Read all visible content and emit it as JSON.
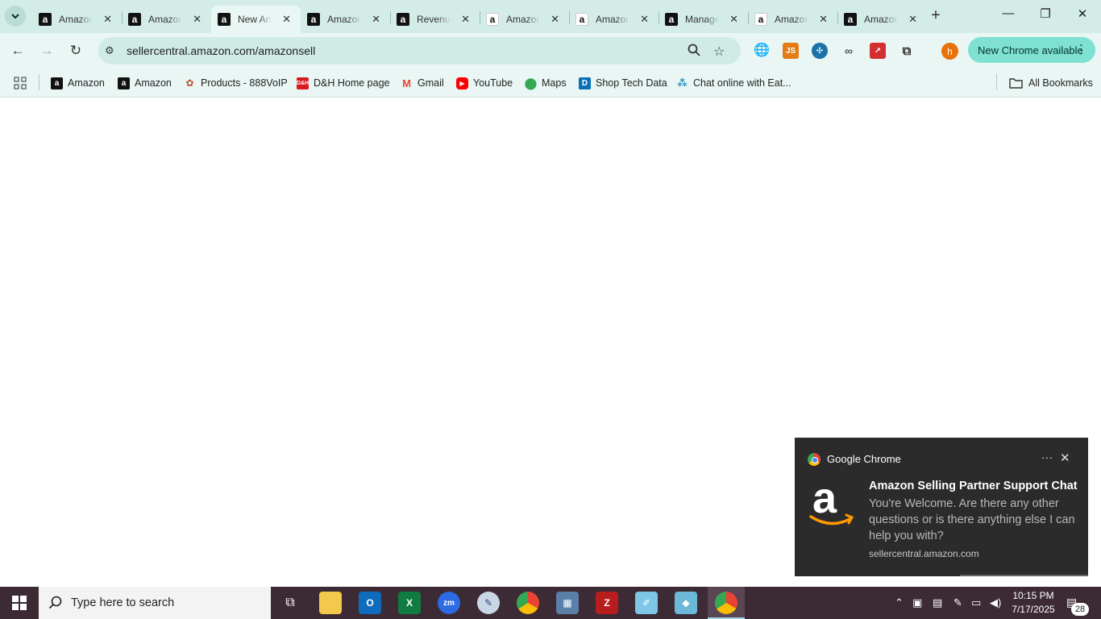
{
  "browser": {
    "tabs": [
      {
        "title": "Amazon",
        "favicon": "amazon-a-dark",
        "active": false
      },
      {
        "title": "Amazon",
        "favicon": "amazon-a-dark",
        "active": false
      },
      {
        "title": "New Amazon",
        "favicon": "amazon-a-dark",
        "active": true
      },
      {
        "title": "Amazon",
        "favicon": "amazon-a-dark",
        "active": false
      },
      {
        "title": "Revenue",
        "favicon": "amazon-a-dark",
        "active": false
      },
      {
        "title": "Amazon",
        "favicon": "amazon-a-light",
        "active": false
      },
      {
        "title": "Amazon",
        "favicon": "amazon-a-light",
        "active": false
      },
      {
        "title": "Manage",
        "favicon": "amazon-a-dark",
        "active": false
      },
      {
        "title": "Amazon",
        "favicon": "amazon-a-light",
        "active": false
      },
      {
        "title": "Amazon",
        "favicon": "amazon-a-dark",
        "active": false
      }
    ],
    "url": "sellercentral.amazon.com/amazonsell",
    "update_chip": "New Chrome available",
    "profile_initial": "h",
    "bookmarks": [
      {
        "label": "Amazon",
        "icon": "amazon-icon"
      },
      {
        "label": "Amazon",
        "icon": "amazon-icon"
      },
      {
        "label": "Products - 888VoIP",
        "icon": "voip-icon"
      },
      {
        "label": "D&H Home page",
        "icon": "dh-icon"
      },
      {
        "label": "Gmail",
        "icon": "gmail-icon"
      },
      {
        "label": "YouTube",
        "icon": "youtube-icon"
      },
      {
        "label": "Maps",
        "icon": "maps-icon"
      },
      {
        "label": "Shop Tech Data",
        "icon": "techdata-icon"
      },
      {
        "label": "Chat online with Eat...",
        "icon": "chat-icon"
      }
    ],
    "all_bookmarks": "All Bookmarks"
  },
  "notification": {
    "app": "Google Chrome",
    "title": "Amazon Selling Partner Support Chat",
    "body": "You're Welcome. Are there any other questions or is there anything else I can help you with?",
    "source": "sellercentral.amazon.com"
  },
  "taskbar": {
    "search_placeholder": "Type here to search",
    "time": "10:15 PM",
    "date": "7/17/2025",
    "notification_count": "28"
  },
  "colors": {
    "tabstrip": "#d3ece8",
    "toolbar": "#e9f6f4",
    "update_chip": "#7ee1d1",
    "taskbar": "#3c2a35",
    "toast": "#2b2b2b"
  }
}
